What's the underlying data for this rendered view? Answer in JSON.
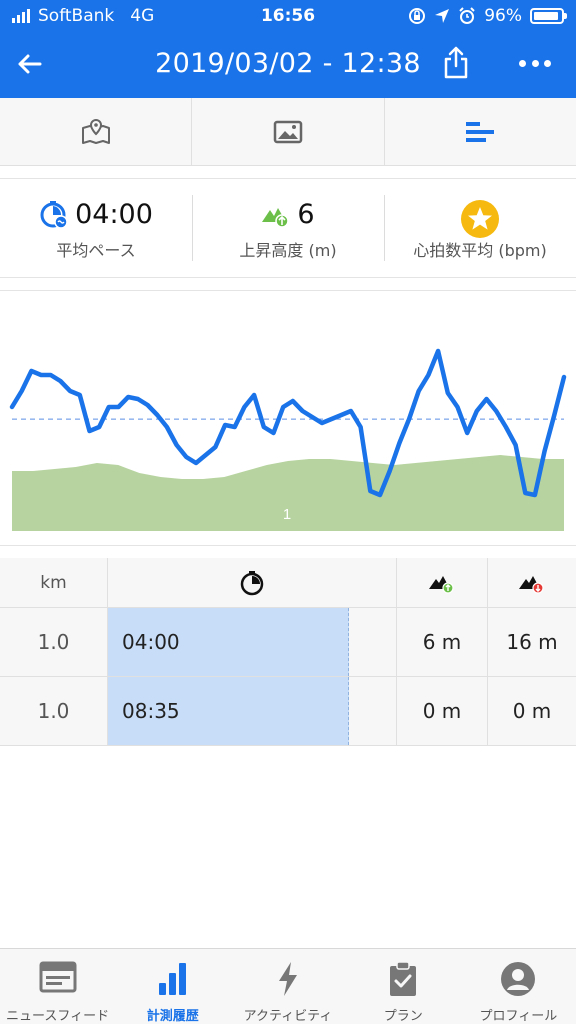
{
  "status": {
    "carrier": "SoftBank",
    "network": "4G",
    "time": "16:56",
    "battery": "96%"
  },
  "header": {
    "title": "2019/03/02 - 12:38",
    "back_icon": "arrow-left-icon",
    "share_icon": "share-icon",
    "more_icon": "more-dots-icon"
  },
  "tabs": [
    {
      "icon": "map-icon"
    },
    {
      "icon": "image-icon"
    },
    {
      "icon": "bar-list-icon",
      "active": true
    }
  ],
  "stats": [
    {
      "value": "04:00",
      "label": "平均ペース",
      "icon": "pace-icon"
    },
    {
      "value": "6",
      "label": "上昇高度 (m)",
      "icon": "elevation-gain-icon"
    },
    {
      "value": "",
      "label": "心拍数平均 (bpm)",
      "icon": "star-icon"
    }
  ],
  "chart_data": {
    "type": "line",
    "series": [
      {
        "values": [
          62,
          70,
          80,
          78,
          78,
          75,
          70,
          68,
          50,
          52,
          62,
          62,
          67,
          66,
          63,
          58,
          52,
          43,
          37,
          34,
          38,
          42,
          53,
          52,
          62,
          68,
          52,
          49,
          62,
          65,
          60,
          57,
          54,
          56,
          58,
          60,
          52,
          20,
          18,
          30,
          44,
          56,
          70,
          78,
          90,
          69,
          62,
          49,
          60,
          66,
          60,
          52,
          43,
          19,
          18,
          40,
          58,
          77
        ]
      }
    ],
    "elevation_values": [
      30,
      30,
      31,
      32,
      34,
      33,
      29,
      27,
      26,
      26,
      27,
      30,
      33,
      35,
      36,
      36,
      35,
      34,
      33,
      34,
      35,
      36,
      37,
      38,
      37,
      36,
      36
    ],
    "average_line": true,
    "area_label": "1",
    "grid": false
  },
  "table": {
    "headers": {
      "km": "km",
      "time_icon": "stopwatch-icon",
      "up_icon": "ascent-icon",
      "down_icon": "descent-icon"
    },
    "rows": [
      {
        "km": "1.0",
        "time": "04:00",
        "up": "6 m",
        "down": "16 m",
        "bar": 1.0
      },
      {
        "km": "1.0",
        "time": "08:35",
        "up": "0 m",
        "down": "0 m",
        "bar": 1.0
      }
    ]
  },
  "nav": [
    {
      "label": "ニュースフィード",
      "icon": "newsfeed-icon",
      "active": false
    },
    {
      "label": "計測履歴",
      "icon": "history-chart-icon",
      "active": true
    },
    {
      "label": "アクティビティ",
      "icon": "lightning-icon",
      "active": false
    },
    {
      "label": "プラン",
      "icon": "clipboard-check-icon",
      "active": false
    },
    {
      "label": "プロフィール",
      "icon": "profile-icon",
      "active": false
    }
  ],
  "colors": {
    "primary": "#1a73e8",
    "line": "#1a73e8",
    "elevation_fill": "#b7d4a0",
    "pace_bar": "#c8ddf7",
    "star": "#f5b90f",
    "up_green": "#6cc04a",
    "down_red": "#e53935"
  }
}
